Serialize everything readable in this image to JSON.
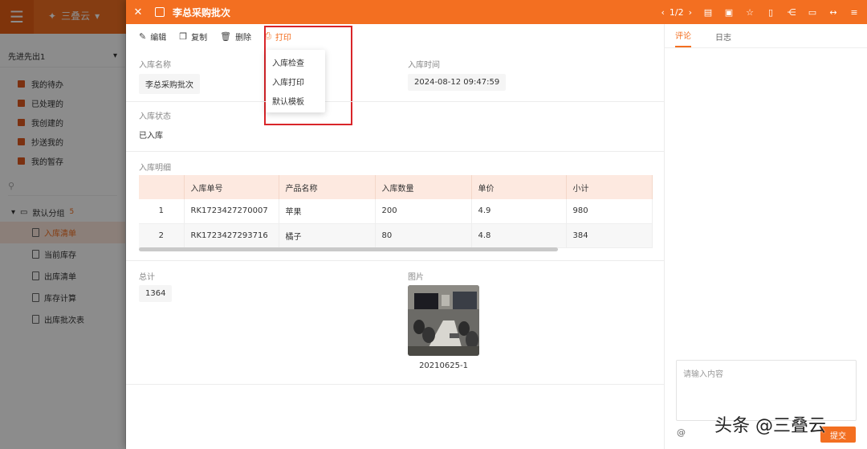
{
  "bg": {
    "app_name": "三叠云",
    "sidebar_head": "先进先出1",
    "items": [
      "我的待办",
      "已处理的",
      "我创建的",
      "抄送我的",
      "我的暂存"
    ],
    "group": {
      "label": "默认分组",
      "count": "5"
    },
    "subs": [
      "入库清单",
      "当前库存",
      "出库清单",
      "库存计算",
      "出库批次表"
    ]
  },
  "drawer": {
    "title": "李总采购批次",
    "pager": "1/2",
    "toolbar": {
      "edit": "编辑",
      "copy": "复制",
      "delete": "删除",
      "print": "打印"
    },
    "print_menu": [
      "入库检查",
      "入库打印",
      "默认模板"
    ],
    "fields": {
      "name_label": "入库名称",
      "name_value": "李总采购批次",
      "time_label": "入库时间",
      "time_value": "2024-08-12 09:47:59",
      "status_label": "入库状态",
      "status_value": "已入库",
      "detail_label": "入库明细",
      "total_label": "总计",
      "total_value": "1364",
      "image_label": "图片",
      "image_caption": "20210625-1"
    },
    "table": {
      "headers": [
        "",
        "入库单号",
        "产品名称",
        "入库数量",
        "单价",
        "小计"
      ],
      "rows": [
        [
          "1",
          "RK1723427270007",
          "苹果",
          "200",
          "4.9",
          "980"
        ],
        [
          "2",
          "RK1723427293716",
          "橘子",
          "80",
          "4.8",
          "384"
        ]
      ]
    },
    "side": {
      "tabs": [
        "评论",
        "日志"
      ],
      "comment_placeholder": "请输入内容",
      "send": "提交"
    }
  },
  "watermark": "头条 @三叠云",
  "colors": {
    "accent": "#f36f21",
    "highlight": "#d9252a"
  }
}
